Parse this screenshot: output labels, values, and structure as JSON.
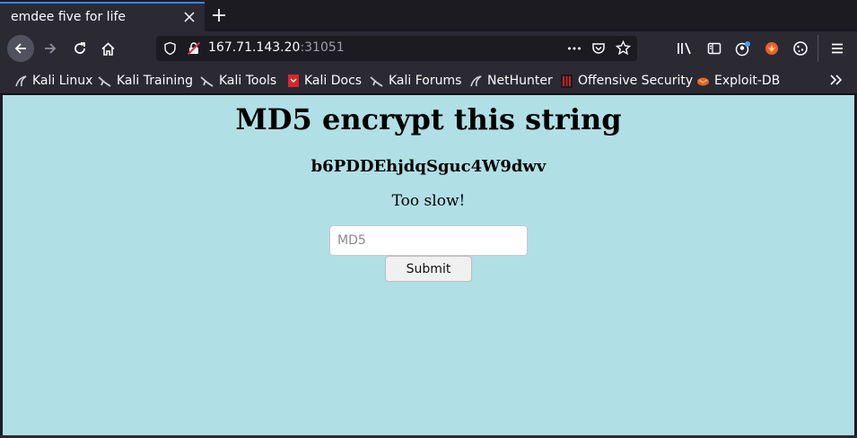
{
  "browser": {
    "tab": {
      "title": "emdee five for life"
    },
    "url": {
      "host": "167.71.143.20",
      "port": ":31051"
    },
    "bookmarks": [
      {
        "label": "Kali Linux",
        "icon": "kali-dragon-icon"
      },
      {
        "label": "Kali Training",
        "icon": "kali-dragon-icon"
      },
      {
        "label": "Kali Tools",
        "icon": "kali-dragon-icon"
      },
      {
        "label": "Kali Docs",
        "icon": "kali-docs-icon"
      },
      {
        "label": "Kali Forums",
        "icon": "kali-dragon-icon"
      },
      {
        "label": "NetHunter",
        "icon": "nethunter-icon"
      },
      {
        "label": "Offensive Security",
        "icon": "offsec-icon"
      },
      {
        "label": "Exploit-DB",
        "icon": "exploit-db-icon"
      }
    ]
  },
  "page": {
    "heading": "MD5 encrypt this string",
    "challenge_string": "b6PDDEhjdqSguc4W9dwv",
    "status": "Too slow!",
    "input": {
      "placeholder": "MD5",
      "value": ""
    },
    "submit_label": "Submit"
  },
  "colors": {
    "page_background": "#b0dfe5",
    "tab_accent": "#3b82f6",
    "toolbar": "#2b2a33"
  }
}
